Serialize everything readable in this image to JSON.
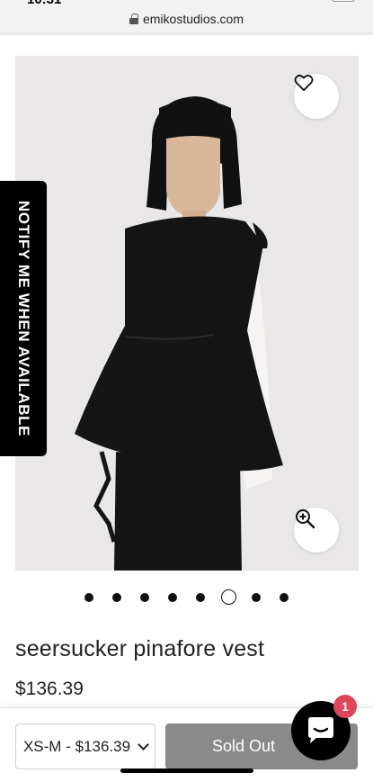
{
  "browser": {
    "time": "10:31",
    "url": "emikostudios.com"
  },
  "notify_tab": {
    "label": "NOTIFY ME WHEN AVAILABLE"
  },
  "carousel": {
    "total": 8,
    "active_index": 5
  },
  "product": {
    "title": "seersucker pinafore vest",
    "price": "$136.39"
  },
  "bottom_bar": {
    "variant_label": "XS-M - $136.39",
    "sold_out_label": "Sold Out"
  },
  "chat": {
    "badge_count": "1"
  },
  "icons": {
    "wishlist": "heart-icon",
    "zoom": "zoom-in-icon",
    "chat": "chat-bubble-icon",
    "lock": "lock-icon",
    "dropdown": "chevron-down-icon"
  },
  "colors": {
    "sold_out_bg": "#8a8a8a",
    "badge_bg": "#e0455a",
    "notify_bg": "#000000"
  }
}
